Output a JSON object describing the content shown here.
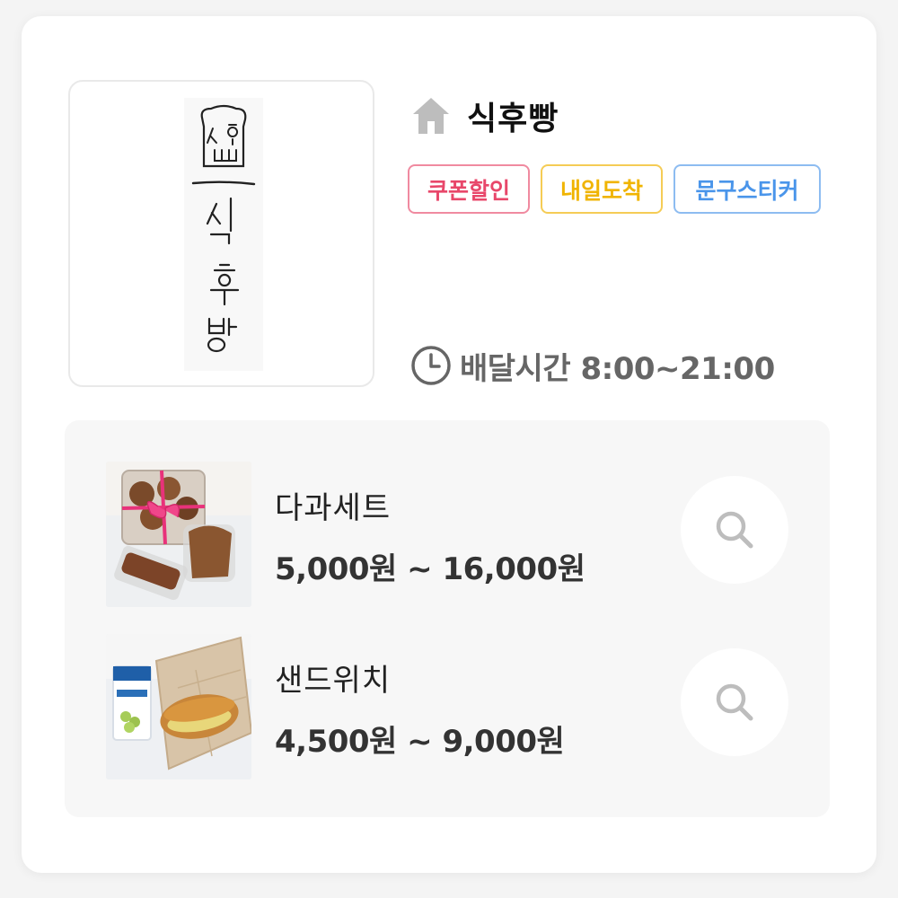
{
  "store": {
    "name": "식후빵",
    "logo_text": "식후빵",
    "badges": [
      "쿠폰할인",
      "내일도착",
      "문구스티커"
    ],
    "delivery": "배달시간 8:00~21:00",
    "icons": {
      "home": "home-icon",
      "clock": "clock-icon"
    }
  },
  "colors": {
    "badge_red": "#e8476a",
    "badge_yellow": "#f0b400",
    "badge_blue": "#4a95ea",
    "panel_bg": "#f7f7f7",
    "icon_gray": "#bdbdbd"
  },
  "menu": {
    "items": [
      {
        "name": "다과세트",
        "price": "5,000원 ~ 16,000원",
        "image": "dessert-set-photo",
        "action_icon": "search-icon"
      },
      {
        "name": "샌드위치",
        "price": "4,500원 ~ 9,000원",
        "image": "sandwich-photo",
        "action_icon": "search-icon"
      }
    ]
  }
}
